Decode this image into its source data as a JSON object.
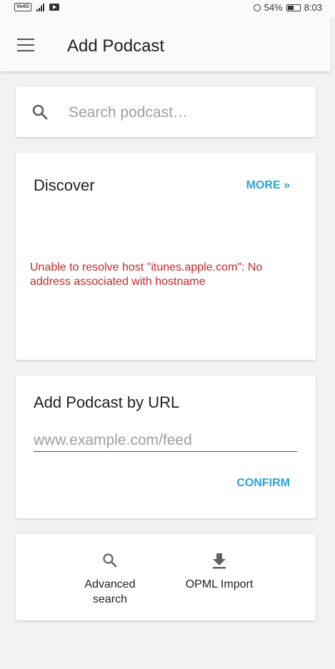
{
  "status_bar": {
    "volte": "Vo4G",
    "battery": "54%",
    "battery_level": 0.54,
    "time": "8:03"
  },
  "app_bar": {
    "title": "Add Podcast",
    "menu_icon": "menu-icon"
  },
  "search": {
    "placeholder": "Search podcast…",
    "value": "",
    "icon": "search-icon"
  },
  "discover": {
    "title": "Discover",
    "more_label": "MORE »",
    "error": "Unable to resolve host \"itunes.apple.com\": No address associated with hostname"
  },
  "add_by_url": {
    "title": "Add Podcast by URL",
    "placeholder": "www.example.com/feed",
    "value": "",
    "confirm_label": "CONFIRM"
  },
  "actions": {
    "advanced_search_label": "Advanced search",
    "opml_import_label": "OPML Import",
    "advanced_search_icon": "search-icon",
    "opml_import_icon": "download-icon"
  },
  "colors": {
    "accent": "#2ba3d4",
    "error": "#c62828",
    "background": "#f2f2f2"
  }
}
